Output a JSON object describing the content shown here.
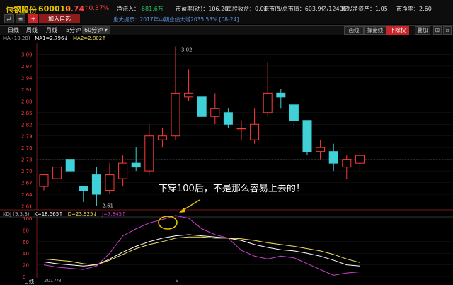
{
  "header": {
    "name": "包钢股份",
    "code": "600010",
    "price": "2.74",
    "change": "↑0.37%",
    "stats": [
      {
        "label": "净流入：",
        "value": "-681.6万",
        "color": "green"
      },
      {
        "label": "市盈率(动)：",
        "value": "106.20",
        "color": "white"
      },
      {
        "label": "每股收益：",
        "value": "0.01",
        "color": "white"
      },
      {
        "label": "流市值/总市值：",
        "value": "603.9亿/1249亿",
        "color": "white"
      },
      {
        "label": "每股净资产：",
        "value": "1.05",
        "color": "white"
      },
      {
        "label": "市净率：",
        "value": "2.60",
        "color": "white"
      }
    ],
    "add_watch": "加入自选",
    "hint": "重大提示：2017年中期业绩大增2035.53%  [08-24]"
  },
  "tabs": [
    "日线",
    "周线",
    "月线",
    "5分钟",
    "60分钟"
  ],
  "right_buttons": [
    "画线",
    "操盘线",
    "下除权",
    "叠加"
  ],
  "ma": {
    "label": "MA (10,20)",
    "ma1": "MA1=2.796↓",
    "ma2": "MA2=2.802↑"
  },
  "kdj": {
    "label": "KDJ (9,3,3)",
    "k": "K=18.565↑",
    "d": "D=23.925↓",
    "j": "J=7.845↑"
  },
  "price_axis": [
    "3.00",
    "2.97",
    "2.94",
    "2.91",
    "2.88",
    "2.85",
    "2.82",
    "2.79",
    "2.76",
    "2.73",
    "2.70",
    "2.67",
    "2.64",
    "2.61"
  ],
  "kdj_axis": [
    "100",
    "80",
    "60",
    "40",
    "20",
    "0"
  ],
  "high_label": "3.02",
  "low_label": "2.61",
  "annotation": "下穿100后，不是那么容易上去的！",
  "x_labels": [
    "日线",
    "2017/8",
    "9"
  ],
  "chart_data": {
    "type": "candlestick",
    "ylim": [
      2.6,
      3.03
    ],
    "current_price": 2.73,
    "candles": [
      {
        "o": 2.66,
        "c": 2.69,
        "h": 2.69,
        "l": 2.65
      },
      {
        "o": 2.68,
        "c": 2.71,
        "h": 2.71,
        "l": 2.67
      },
      {
        "o": 2.73,
        "c": 2.7,
        "h": 2.73,
        "l": 2.7
      },
      {
        "o": 2.66,
        "c": 2.65,
        "h": 2.66,
        "l": 2.62
      },
      {
        "o": 2.69,
        "c": 2.64,
        "h": 2.71,
        "l": 2.61
      },
      {
        "o": 2.65,
        "c": 2.69,
        "h": 2.72,
        "l": 2.64
      },
      {
        "o": 2.68,
        "c": 2.72,
        "h": 2.74,
        "l": 2.66
      },
      {
        "o": 2.72,
        "c": 2.71,
        "h": 2.76,
        "l": 2.7
      },
      {
        "o": 2.7,
        "c": 2.79,
        "h": 2.82,
        "l": 2.69
      },
      {
        "o": 2.78,
        "c": 2.79,
        "h": 2.81,
        "l": 2.76
      },
      {
        "o": 2.79,
        "c": 2.9,
        "h": 3.02,
        "l": 2.78
      },
      {
        "o": 2.89,
        "c": 2.9,
        "h": 2.96,
        "l": 2.88
      },
      {
        "o": 2.89,
        "c": 2.84,
        "h": 2.89,
        "l": 2.84
      },
      {
        "o": 2.84,
        "c": 2.86,
        "h": 2.9,
        "l": 2.82
      },
      {
        "o": 2.85,
        "c": 2.82,
        "h": 2.86,
        "l": 2.81
      },
      {
        "o": 2.81,
        "c": 2.81,
        "h": 2.83,
        "l": 2.78
      },
      {
        "o": 2.78,
        "c": 2.82,
        "h": 2.86,
        "l": 2.77
      },
      {
        "o": 2.85,
        "c": 2.9,
        "h": 2.98,
        "l": 2.84
      },
      {
        "o": 2.9,
        "c": 2.89,
        "h": 2.91,
        "l": 2.86
      },
      {
        "o": 2.87,
        "c": 2.83,
        "h": 2.87,
        "l": 2.81
      },
      {
        "o": 2.83,
        "c": 2.75,
        "h": 2.83,
        "l": 2.74
      },
      {
        "o": 2.75,
        "c": 2.76,
        "h": 2.78,
        "l": 2.73
      },
      {
        "o": 2.75,
        "c": 2.72,
        "h": 2.77,
        "l": 2.7
      },
      {
        "o": 2.71,
        "c": 2.73,
        "h": 2.74,
        "l": 2.68
      },
      {
        "o": 2.72,
        "c": 2.74,
        "h": 2.75,
        "l": 2.7
      }
    ],
    "kdj": {
      "ylim": [
        0,
        100
      ],
      "K": [
        25,
        22,
        20,
        18,
        20,
        30,
        42,
        52,
        60,
        66,
        70,
        72,
        70,
        68,
        66,
        62,
        55,
        50,
        46,
        44,
        40,
        35,
        28,
        20,
        18
      ],
      "D": [
        30,
        28,
        26,
        22,
        20,
        28,
        38,
        48,
        55,
        60,
        66,
        68,
        68,
        66,
        66,
        65,
        62,
        58,
        55,
        52,
        48,
        44,
        38,
        30,
        24
      ],
      "J": [
        20,
        16,
        14,
        12,
        18,
        40,
        70,
        82,
        92,
        98,
        108,
        100,
        82,
        72,
        66,
        45,
        35,
        30,
        35,
        32,
        22,
        12,
        2,
        6,
        8
      ]
    }
  }
}
